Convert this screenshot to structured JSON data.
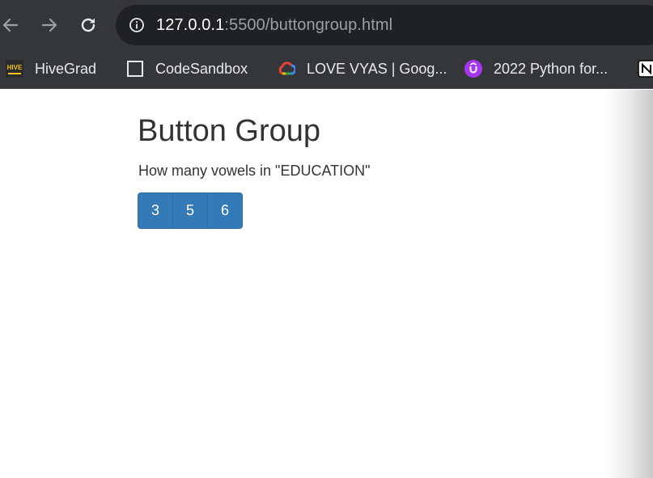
{
  "browser": {
    "url_host": "127.0.0.1",
    "url_rest": ":5500/buttongroup.html",
    "bookmarks": [
      {
        "label": "HiveGrad",
        "icon": "hivegrad-icon"
      },
      {
        "label": "CodeSandbox",
        "icon": "codesandbox-icon"
      },
      {
        "label": "LOVE VYAS | Goog...",
        "icon": "google-cloud-icon"
      },
      {
        "label": "2022 Python for...",
        "icon": "udemy-icon"
      },
      {
        "label": "",
        "icon": "notion-icon"
      }
    ],
    "hive_logo_text": "HIVE"
  },
  "page": {
    "heading": "Button Group",
    "question": "How many vowels in \"EDUCATION\"",
    "options": [
      "3",
      "5",
      "6"
    ],
    "button_color": "#337ab7"
  }
}
